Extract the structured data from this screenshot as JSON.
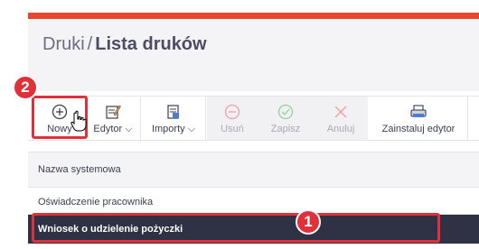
{
  "header": {
    "breadcrumb_root": "Druki",
    "separator": "/",
    "title": "Lista druków"
  },
  "toolbar": {
    "new_label": "Nowy",
    "editor_label": "Edytor",
    "imports_label": "Importy",
    "delete_label": "Usuń",
    "save_label": "Zapisz",
    "cancel_label": "Anuluj",
    "install_editor_label": "Zainstaluj edytor"
  },
  "table": {
    "column_header": "Nazwa systemowa",
    "rows": [
      "Oświadczenie pracownika",
      "Wniosek o udzielenie pożyczki"
    ]
  },
  "annotations": {
    "badge_1": "1",
    "badge_2": "2"
  },
  "colors": {
    "accent_red": "#e0303a",
    "top_bar": "#e8472f",
    "selected_row": "#2f3245"
  },
  "icons": {
    "new": "plus-circle-icon",
    "editor": "edit-document-icon",
    "imports": "import-document-icon",
    "delete": "minus-circle-icon",
    "save": "check-circle-icon",
    "cancel": "x-icon",
    "install_editor": "printer-icon",
    "cursor": "hand-pointer-icon"
  }
}
